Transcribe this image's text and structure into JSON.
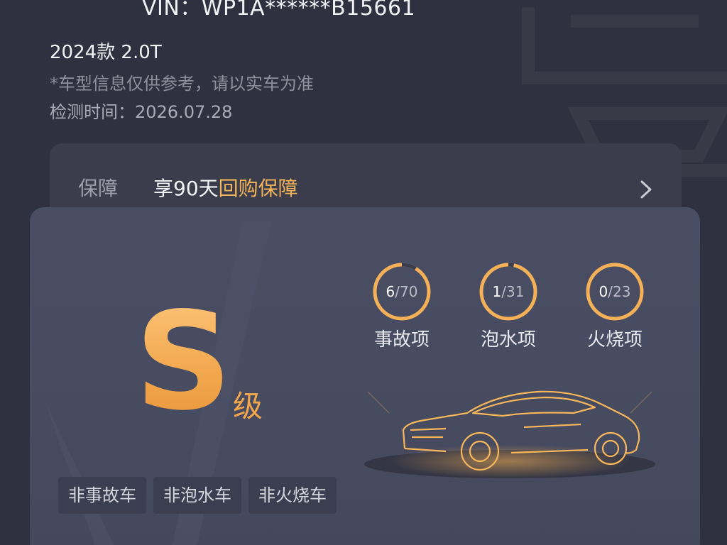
{
  "header": {
    "vin": "VIN：WP1A******B15661",
    "model": "2024款 2.0T",
    "disclaimer": "*车型信息仅供参考，请以实车为准",
    "inspection_time": "检测时间：2026.07.28"
  },
  "guarantee": {
    "label": "保障",
    "text_prefix": "享90天",
    "text_highlight": "回购保障",
    "arrow_icon": "chevron-right-icon"
  },
  "report": {
    "grade_letter": "S",
    "grade_suffix": "级",
    "stats": [
      {
        "count": "6",
        "total": "/70",
        "label": "事故项",
        "fraction": 0.0857
      },
      {
        "count": "1",
        "total": "/31",
        "label": "泡水项",
        "fraction": 0.0323
      },
      {
        "count": "0",
        "total": "/23",
        "label": "火烧项",
        "fraction": 0
      }
    ],
    "tags": [
      "非事故车",
      "非泡水车",
      "非火烧车"
    ]
  },
  "colors": {
    "accent": "#f2a64c",
    "background": "#2f3140",
    "card": "#3b3d4c",
    "report_card": "#484c61"
  }
}
